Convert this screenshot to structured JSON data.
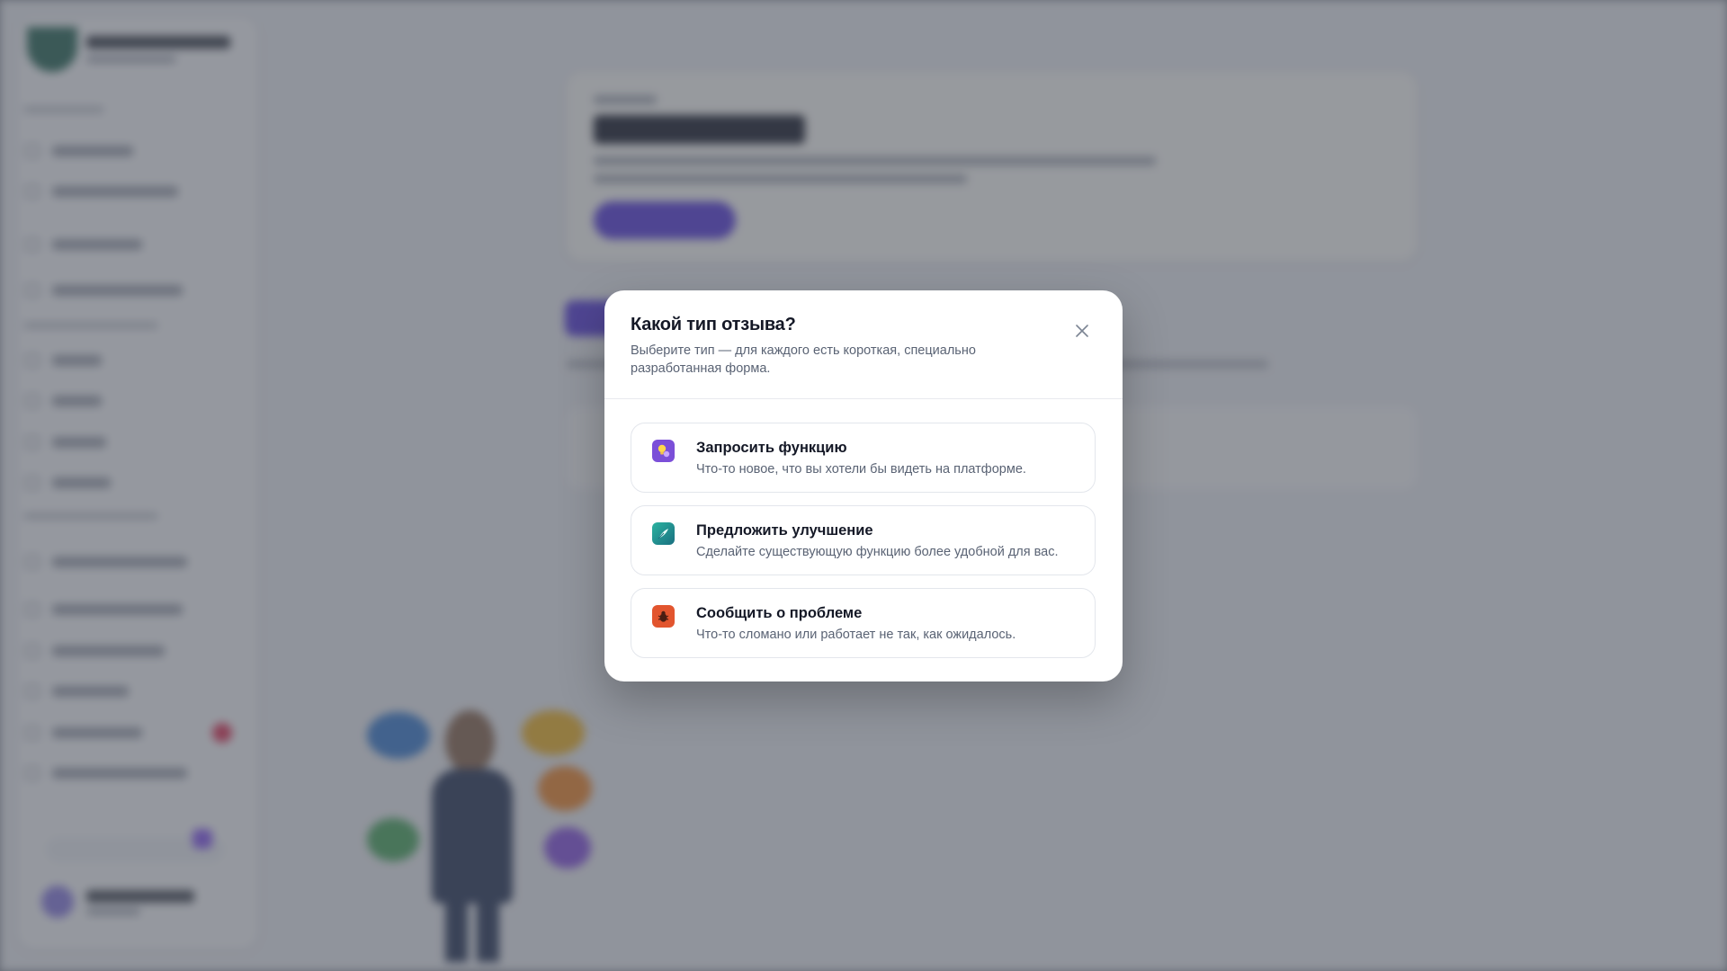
{
  "modal": {
    "title": "Какой тип отзыва?",
    "subtitle": "Выберите тип — для каждого есть короткая, специально разработанная форма.",
    "close_icon": "close-icon",
    "options": [
      {
        "icon": "lightbulb-icon",
        "title": "Запросить функцию",
        "description": "Что-то новое, что вы хотели бы видеть на платформе.",
        "color": "#7b4fd8"
      },
      {
        "icon": "feather-icon",
        "title": "Предложить улучшение",
        "description": "Сделайте существующую функцию более удобной для вас.",
        "color": "#2bb3a0"
      },
      {
        "icon": "bug-icon",
        "title": "Сообщить о проблеме",
        "description": "Что-то сломано или работает не так, как ожидалось.",
        "color": "#e2552e"
      }
    ]
  },
  "colors": {
    "accent": "#5b3fdc",
    "overlay": "rgba(70,74,86,.55)"
  }
}
